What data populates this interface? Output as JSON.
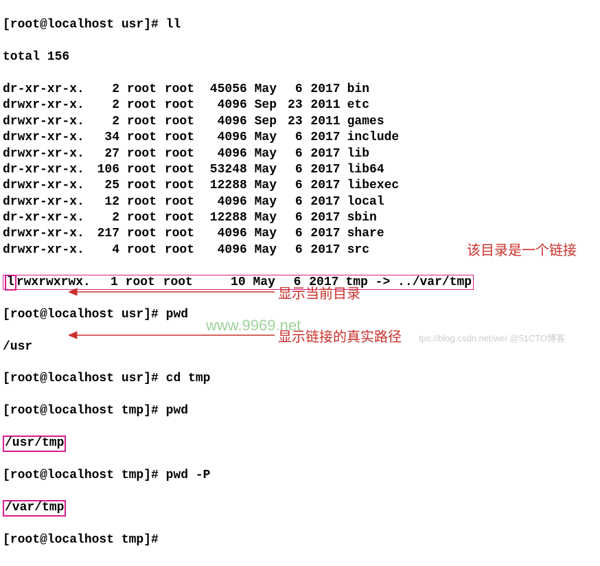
{
  "prompt_usr": "[root@localhost usr]#",
  "prompt_tmp": "[root@localhost tmp]#",
  "cmd_ll": "ll",
  "total": "total 156",
  "rows": [
    {
      "perm": "dr-xr-xr-x.",
      "l": "2",
      "o": "root",
      "g": "root",
      "s": "45056",
      "m": "May",
      "d": "6",
      "y": "2017",
      "n": "bin"
    },
    {
      "perm": "drwxr-xr-x.",
      "l": "2",
      "o": "root",
      "g": "root",
      "s": "4096",
      "m": "Sep",
      "d": "23",
      "y": "2011",
      "n": "etc"
    },
    {
      "perm": "drwxr-xr-x.",
      "l": "2",
      "o": "root",
      "g": "root",
      "s": "4096",
      "m": "Sep",
      "d": "23",
      "y": "2011",
      "n": "games"
    },
    {
      "perm": "drwxr-xr-x.",
      "l": "34",
      "o": "root",
      "g": "root",
      "s": "4096",
      "m": "May",
      "d": "6",
      "y": "2017",
      "n": "include"
    },
    {
      "perm": "drwxr-xr-x.",
      "l": "27",
      "o": "root",
      "g": "root",
      "s": "4096",
      "m": "May",
      "d": "6",
      "y": "2017",
      "n": "lib"
    },
    {
      "perm": "dr-xr-xr-x.",
      "l": "106",
      "o": "root",
      "g": "root",
      "s": "53248",
      "m": "May",
      "d": "6",
      "y": "2017",
      "n": "lib64"
    },
    {
      "perm": "drwxr-xr-x.",
      "l": "25",
      "o": "root",
      "g": "root",
      "s": "12288",
      "m": "May",
      "d": "6",
      "y": "2017",
      "n": "libexec"
    },
    {
      "perm": "drwxr-xr-x.",
      "l": "12",
      "o": "root",
      "g": "root",
      "s": "4096",
      "m": "May",
      "d": "6",
      "y": "2017",
      "n": "local"
    },
    {
      "perm": "dr-xr-xr-x.",
      "l": "2",
      "o": "root",
      "g": "root",
      "s": "12288",
      "m": "May",
      "d": "6",
      "y": "2017",
      "n": "sbin"
    },
    {
      "perm": "drwxr-xr-x.",
      "l": "217",
      "o": "root",
      "g": "root",
      "s": "4096",
      "m": "May",
      "d": "6",
      "y": "2017",
      "n": "share"
    },
    {
      "perm": "drwxr-xr-x.",
      "l": "4",
      "o": "root",
      "g": "root",
      "s": "4096",
      "m": "May",
      "d": "6",
      "y": "2017",
      "n": "src"
    }
  ],
  "symlink": {
    "first": "l",
    "rest": "rwxrwxrwx.",
    "l": "1",
    "o": "root",
    "g": "root",
    "s": "10",
    "m": "May",
    "d": "6",
    "y": "2017",
    "n": "tmp",
    "arrow": " -> ",
    "target": "../var/tmp"
  },
  "cmd_pwd": "pwd",
  "out_usr": "/usr",
  "cmd_cd": "cd tmp",
  "out_usrtmp": "/usr/tmp",
  "cmd_pwdP": "pwd -P",
  "out_vartmp": "/var/tmp",
  "anno_link": "该目录是一个链接",
  "anno_curdir": "显示当前目录",
  "anno_realpath": "显示链接的真实路径",
  "wm1": "www.9969.net",
  "wm2": "tps://blog.csdn.net/wei  @51CTO博客"
}
